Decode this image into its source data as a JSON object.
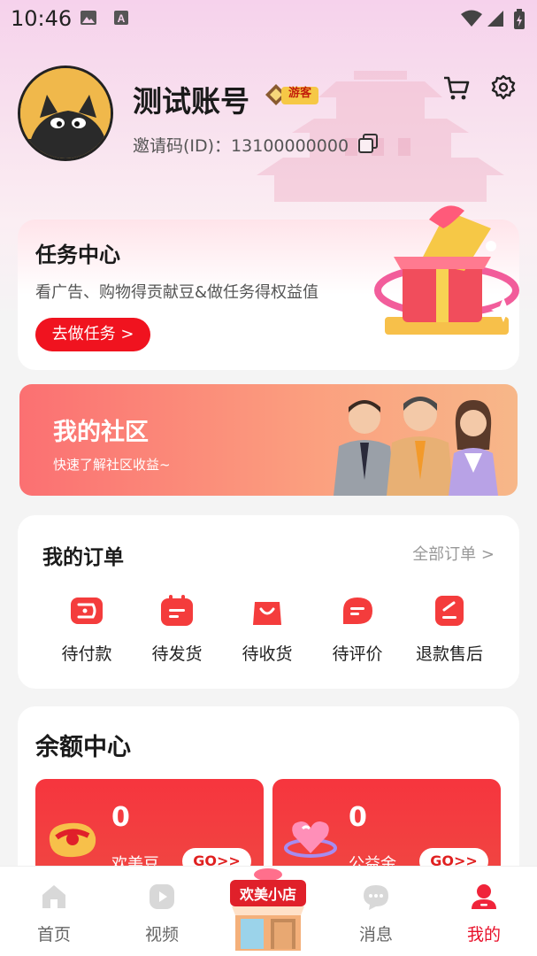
{
  "status_bar": {
    "time": "10:46"
  },
  "profile": {
    "username": "测试账号",
    "badge": "游客",
    "invite_code": "邀请码(ID)：13100000000"
  },
  "task_card": {
    "title": "任务中心",
    "description": "看广告、购物得贡献豆&做任务得权益值",
    "button": "去做任务 >"
  },
  "community": {
    "title": "我的社区",
    "subtitle": "快速了解社区收益~"
  },
  "orders": {
    "title": "我的订单",
    "all_link": "全部订单 >",
    "items": [
      {
        "label": "待付款",
        "icon": "wallet-icon"
      },
      {
        "label": "待发货",
        "icon": "calendar-icon"
      },
      {
        "label": "待收货",
        "icon": "bag-icon"
      },
      {
        "label": "待评价",
        "icon": "comment-icon"
      },
      {
        "label": "退款售后",
        "icon": "refund-icon"
      }
    ]
  },
  "balance": {
    "title": "余额中心",
    "cards": [
      {
        "value": "0",
        "label": "欢美豆",
        "button": "GO>>"
      },
      {
        "value": "0",
        "label": "公益金",
        "button": "GO>>"
      }
    ]
  },
  "bottom_nav": {
    "items": [
      {
        "label": "首页",
        "icon": "home-icon",
        "active": false
      },
      {
        "label": "视频",
        "icon": "play-icon",
        "active": false
      },
      {
        "label": "欢美小店",
        "icon": "shop-icon",
        "active": false
      },
      {
        "label": "消息",
        "icon": "message-icon",
        "active": false
      },
      {
        "label": "我的",
        "icon": "user-icon",
        "active": true
      }
    ]
  },
  "colors": {
    "accent": "#e8102a",
    "primary_red": "#f0131f",
    "community_start": "#fb7072",
    "community_end": "#f7b789"
  }
}
